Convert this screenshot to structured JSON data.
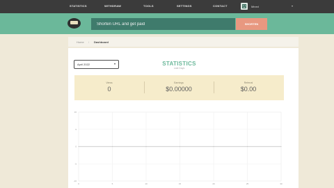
{
  "nav": {
    "items": [
      "STATISTICS",
      "WITHDRAW",
      "TOOLS",
      "SETTINGS",
      "CONTACT"
    ],
    "user_name": "Mined",
    "user_caret": "▾"
  },
  "shortener": {
    "placeholder": "Shorten URL and get paid",
    "button_label": "SHORTEN"
  },
  "breadcrumb": {
    "home": "Home",
    "separator": "/",
    "current": "Dashboard"
  },
  "filter": {
    "selected_month": "April 2022",
    "caret": "▾"
  },
  "statistics": {
    "title": "STATISTICS",
    "subtitle": "Last Days",
    "stats": [
      {
        "label": "Views",
        "value": "0"
      },
      {
        "label": "Earnings",
        "value": "$0.00000"
      },
      {
        "label": "Referral",
        "value": "$0.00"
      }
    ]
  },
  "colors": {
    "accent": "#6bb89a",
    "button": "#e89880",
    "panel": "#f6eccb",
    "background": "#efe9d8"
  },
  "chart_data": {
    "type": "line",
    "x": [
      0,
      5,
      10,
      15,
      20,
      25,
      30
    ],
    "x_ticks": [
      "0",
      "5",
      "10",
      "15",
      "20",
      "25",
      "30"
    ],
    "y_ticks": [
      "-10",
      "-5",
      "0",
      "5",
      "10"
    ],
    "ylim": [
      -10,
      10
    ],
    "series": [
      {
        "values": [
          0,
          0,
          0,
          0,
          0,
          0,
          0
        ]
      }
    ],
    "grid": true
  }
}
